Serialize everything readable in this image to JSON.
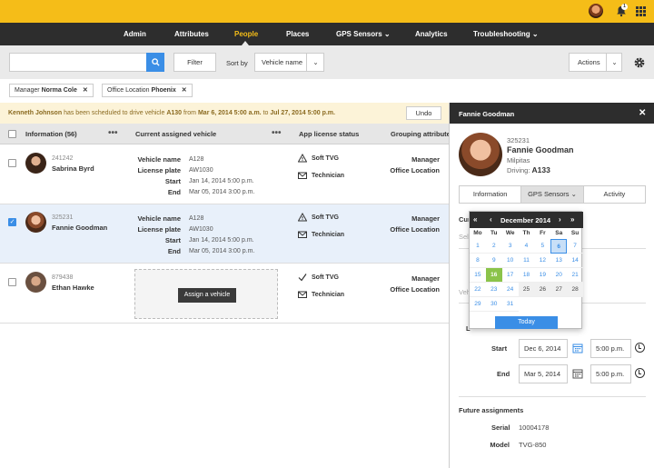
{
  "nav": {
    "items": [
      {
        "label": "Admin"
      },
      {
        "label": "Attributes"
      },
      {
        "label": "People"
      },
      {
        "label": "Places"
      },
      {
        "label": "GPS Sensors"
      },
      {
        "label": "Analytics"
      },
      {
        "label": "Troubleshooting"
      }
    ],
    "active": "People"
  },
  "top": {
    "notif_count": "1"
  },
  "toolbar": {
    "search_placeholder": "",
    "filter_label": "Filter",
    "sort_label": "Sort by",
    "sort_value": "Vehicle name",
    "actions_label": "Actions"
  },
  "filters": [
    {
      "key": "Manager",
      "value": "Norma Cole"
    },
    {
      "key": "Office Location",
      "value": "Phoenix"
    }
  ],
  "notice": {
    "name": "Kenneth Johnson",
    "mid": "has been scheduled to drive vehicle",
    "vehicle": "A130",
    "from": "from",
    "start": "Mar 6, 2014 5:00 a.m.",
    "to": "to",
    "end": "Jul 27, 2014 5:00 p.m.",
    "undo": "Undo"
  },
  "table": {
    "headers": {
      "info": "Information (56)",
      "vehicle": "Current assigned vehicle",
      "license": "App license status",
      "grouping": "Grouping attribute"
    },
    "rows": [
      {
        "id": "241242",
        "name": "Sabrina Byrd",
        "vehicle_name": "A128",
        "license_plate": "AW1030",
        "start": "Jan 14, 2014 5:00 p.m.",
        "end": "Mar 05, 2014 3:00 p.m.",
        "license": "Soft TVG",
        "role": "Technician",
        "manager": "Manager",
        "office": "Office Location"
      },
      {
        "id": "325231",
        "name": "Fannie Goodman",
        "vehicle_name": "A128",
        "license_plate": "AW1030",
        "start": "Jan 14, 2014 5:00 p.m.",
        "end": "Mar 05, 2014 3:00 p.m.",
        "license": "Soft TVG",
        "role": "Technician",
        "manager": "Manager",
        "office": "Office Location"
      },
      {
        "id": "879438",
        "name": "Ethan Hawke",
        "assign": "Assign a vehicle",
        "license": "Soft TVG",
        "role": "Technician",
        "manager": "Manager",
        "office": "Office Location"
      }
    ],
    "labels": {
      "vehicle_name": "Vehicle name",
      "license_plate": "License plate",
      "start": "Start",
      "end": "End"
    }
  },
  "panel": {
    "title": "Fannie Goodman",
    "id": "325231",
    "name": "Fannie Goodman",
    "city": "Milpitas",
    "driving_label": "Driving:",
    "driving": "A133",
    "tabs": [
      {
        "label": "Information"
      },
      {
        "label": "GPS Sensors"
      },
      {
        "label": "Activity"
      }
    ],
    "cur_label": "Cur",
    "sel_label": "Sel",
    "veh_label": "Veh",
    "l_label": "L",
    "start_label": "Start",
    "start_date": "Dec 6, 2014",
    "start_time": "5:00 p.m.",
    "end_label": "End",
    "end_date": "Mar 5, 2014",
    "end_time": "5:00 p.m.",
    "future_label": "Future assignments",
    "serial_label": "Serial",
    "serial": "10004178",
    "model_label": "Model",
    "model": "TVG-850"
  },
  "datepicker": {
    "month": "December 2014",
    "dows": [
      "Mo",
      "Tu",
      "We",
      "Th",
      "Fr",
      "Sa",
      "Su"
    ],
    "days": [
      "1",
      "2",
      "3",
      "4",
      "5",
      "6",
      "7",
      "8",
      "9",
      "10",
      "11",
      "12",
      "13",
      "14",
      "15",
      "16",
      "17",
      "18",
      "19",
      "20",
      "21",
      "22",
      "23",
      "24",
      "25",
      "26",
      "27",
      "28",
      "29",
      "30",
      "31"
    ],
    "today_day": "16",
    "selected_day": "6",
    "today_label": "Today"
  }
}
